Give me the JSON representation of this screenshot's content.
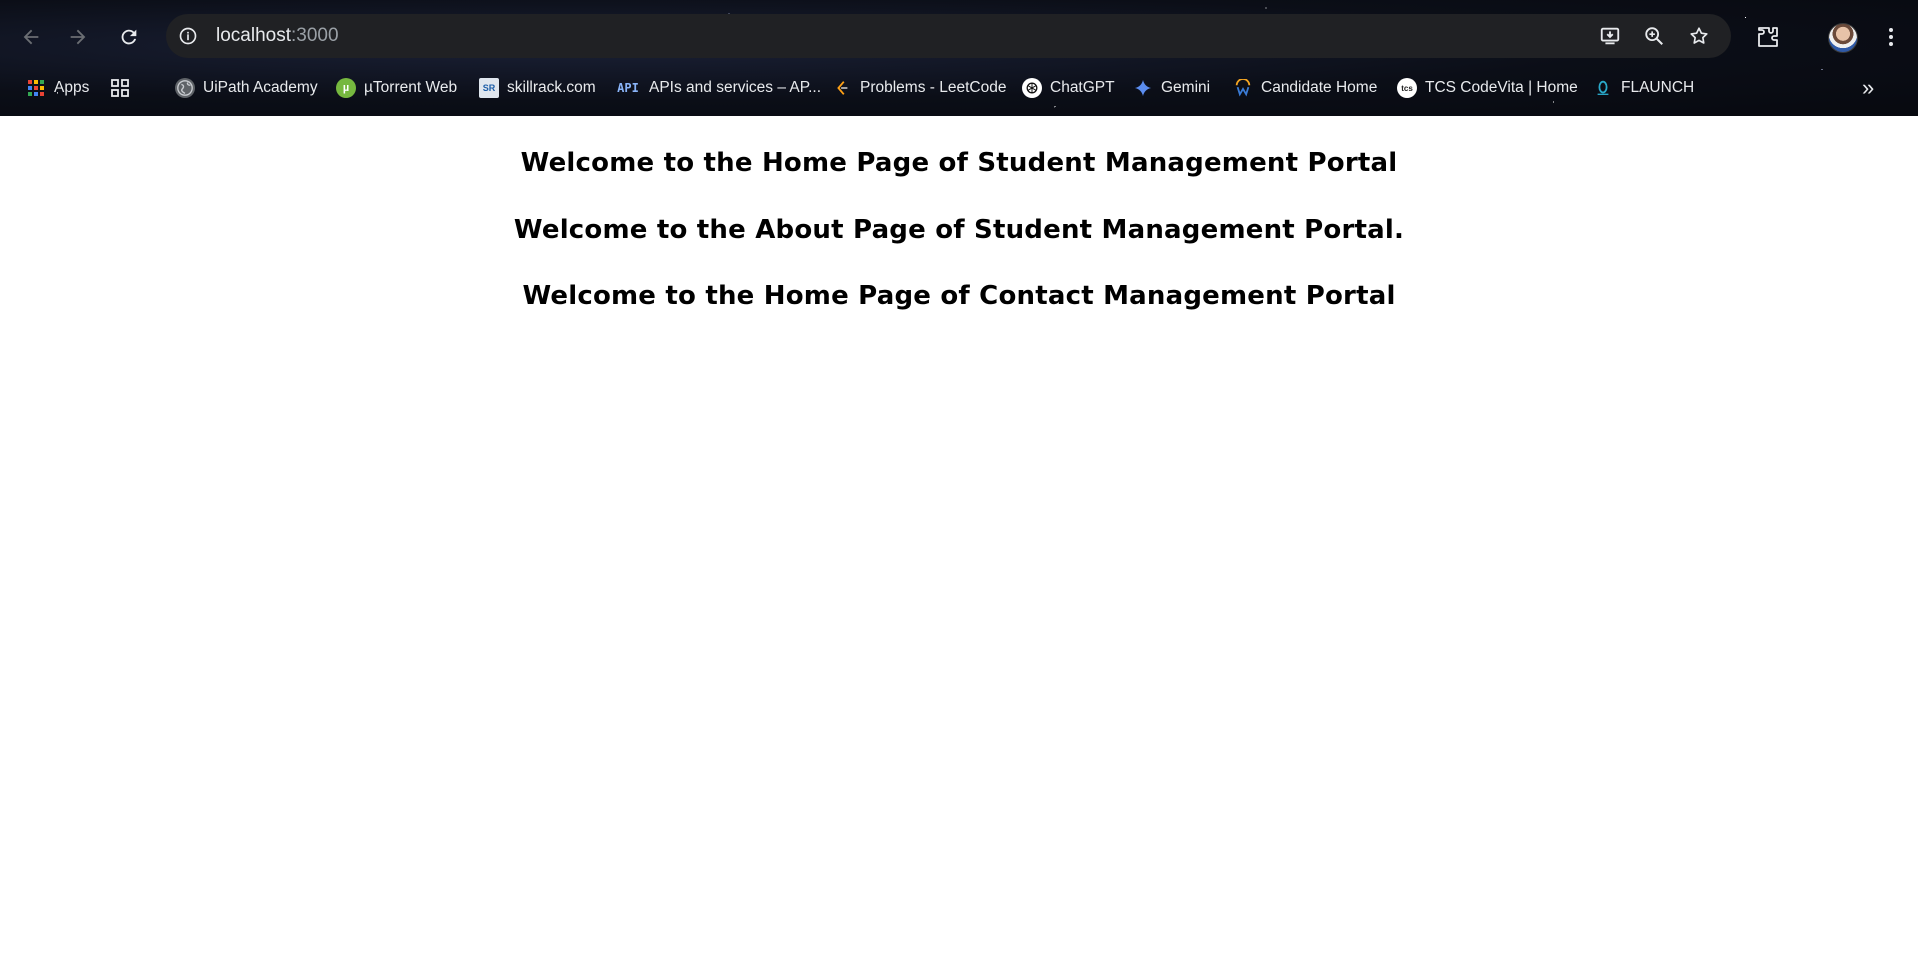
{
  "browser": {
    "url_host": "localhost",
    "url_port": ":3000",
    "bookmarks": [
      {
        "label": "Apps",
        "icon": "apps-grid-icon"
      },
      {
        "label": "",
        "icon": "tab-groups-icon"
      },
      {
        "label": "UiPath Academy",
        "icon": "globe-icon"
      },
      {
        "label": "µTorrent Web",
        "icon": "utorrent-icon"
      },
      {
        "label": "skillrack.com",
        "icon": "skillrack-icon"
      },
      {
        "label": "APIs and services – AP...",
        "icon": "api-icon"
      },
      {
        "label": "Problems - LeetCode",
        "icon": "leetcode-icon"
      },
      {
        "label": "ChatGPT",
        "icon": "chatgpt-icon"
      },
      {
        "label": "Gemini",
        "icon": "gemini-icon"
      },
      {
        "label": "Candidate Home",
        "icon": "workday-icon"
      },
      {
        "label": "TCS CodeVita | Home",
        "icon": "tcs-icon"
      },
      {
        "label": "FLAUNCH",
        "icon": "flaunch-icon"
      }
    ],
    "more_bookmarks": "»"
  },
  "page": {
    "headings": [
      "Welcome to the Home Page of Student Management Portal",
      "Welcome to the About Page of Student Management Portal.",
      "Welcome to the Home Page of Contact Management Portal"
    ]
  },
  "colors": {
    "toolbar_bg": "#0b0e17",
    "omnibox_bg": "#202124",
    "text_light": "#e8eaed",
    "page_bg": "#ffffff",
    "heading_text": "#000000"
  }
}
